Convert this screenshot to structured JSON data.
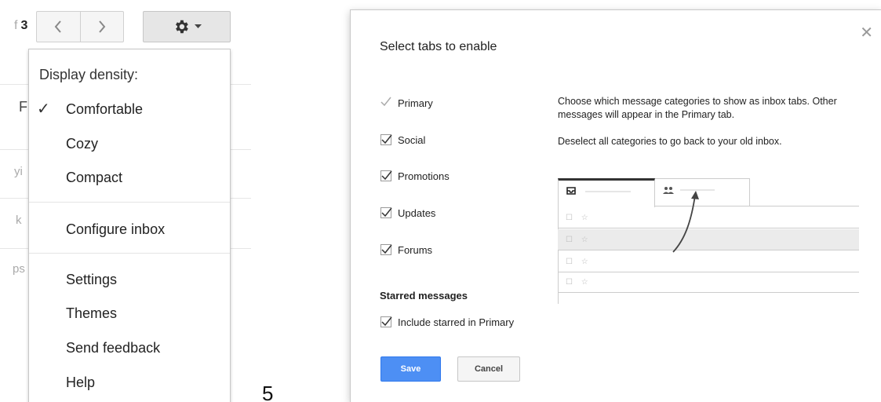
{
  "toolbar": {
    "page_count": "3",
    "page_count_prefix": "f",
    "prev_icon": "chevron-left-icon",
    "next_icon": "chevron-right-icon",
    "gear_icon": "gear-icon"
  },
  "background_fragments": [
    "F",
    "yi",
    "k",
    "ps"
  ],
  "settings_menu": {
    "heading": "Display density:",
    "density_options": [
      {
        "label": "Comfortable",
        "checked": true
      },
      {
        "label": "Cozy",
        "checked": false
      },
      {
        "label": "Compact",
        "checked": false
      }
    ],
    "configure": "Configure inbox",
    "items": [
      "Settings",
      "Themes",
      "Send feedback",
      "Help"
    ]
  },
  "step_number": "5",
  "dialog": {
    "title": "Select tabs to enable",
    "close_icon": "close-icon",
    "categories": [
      {
        "label": "Primary",
        "checked": true,
        "locked": true
      },
      {
        "label": "Social",
        "checked": true,
        "locked": false
      },
      {
        "label": "Promotions",
        "checked": true,
        "locked": false
      },
      {
        "label": "Updates",
        "checked": true,
        "locked": false
      },
      {
        "label": "Forums",
        "checked": true,
        "locked": false
      }
    ],
    "description": [
      "Choose which message categories to show as inbox tabs. Other messages will appear in the Primary tab.",
      "Deselect all categories to go back to your old inbox."
    ],
    "starred_heading": "Starred messages",
    "starred_option": {
      "label": "Include starred in Primary",
      "checked": true
    },
    "save_label": "Save",
    "cancel_label": "Cancel",
    "preview": {
      "tab_icons": [
        "inbox-icon",
        "people-icon"
      ],
      "row_glyph": "☐ ☆",
      "row_count": 4,
      "highlighted_row": 2
    },
    "colors": {
      "save_button": "#4d8ff4",
      "preview_highlight": "#ebebeb"
    }
  }
}
